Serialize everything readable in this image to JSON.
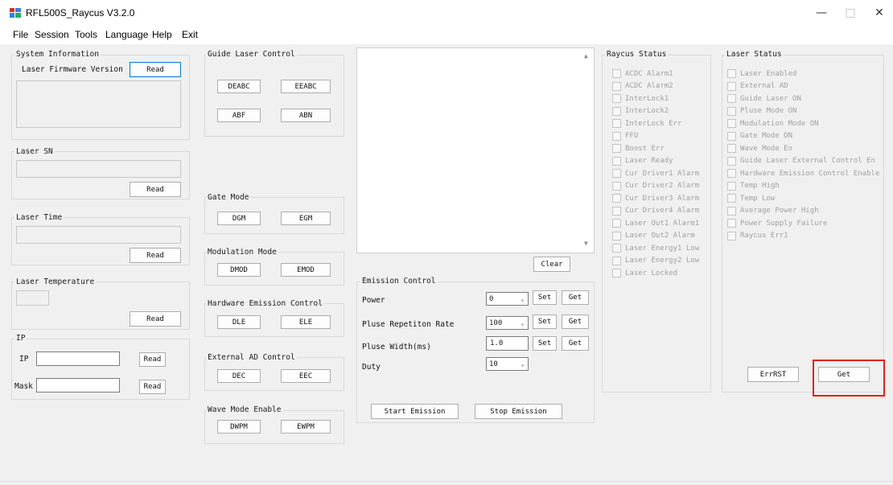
{
  "window": {
    "title": "RFL500S_Raycus V3.2.0"
  },
  "menu": [
    "File",
    "Session",
    "Tools",
    "Language",
    "Help",
    "Exit"
  ],
  "system_info": {
    "title": "System Information",
    "firmware_label": "Laser Firmware Version",
    "read_label": "Read"
  },
  "laser_sn": {
    "title": "Laser SN",
    "read_label": "Read"
  },
  "laser_time": {
    "title": "Laser Time",
    "read_label": "Read"
  },
  "laser_temp": {
    "title": "Laser Temperature",
    "read_label": "Read"
  },
  "ip": {
    "title": "IP",
    "ip_label": "IP",
    "mask_label": "Mask",
    "read_label": "Read"
  },
  "guide_laser": {
    "title": "Guide Laser Control",
    "buttons": [
      "DEABC",
      "EEABC",
      "ABF",
      "ABN"
    ]
  },
  "gate_mode": {
    "title": "Gate Mode",
    "buttons": [
      "DGM",
      "EGM"
    ]
  },
  "modulation_mode": {
    "title": "Modulation Mode",
    "buttons": [
      "DMOD",
      "EMOD"
    ]
  },
  "hardware_emission": {
    "title": "Hardware Emission Control",
    "buttons": [
      "DLE",
      "ELE"
    ]
  },
  "external_ad": {
    "title": "External AD Control",
    "buttons": [
      "DEC",
      "EEC"
    ]
  },
  "wave_mode": {
    "title": "Wave Mode Enable",
    "buttons": [
      "DWPM",
      "EWPM"
    ]
  },
  "log": {
    "clear_label": "Clear"
  },
  "emission": {
    "title": "Emission Control",
    "power_label": "Power",
    "power_value": "0",
    "rate_label": "Pluse Repetiton Rate",
    "rate_value": "100",
    "width_label": "Pluse Width(ms)",
    "width_value": "1.0",
    "duty_label": "Duty",
    "duty_value": "10",
    "set_label": "Set",
    "get_label": "Get",
    "start_label": "Start Emission",
    "stop_label": "Stop Emission"
  },
  "raycus_status": {
    "title": "Raycus Status",
    "items": [
      "ACDC Alarm1",
      "ACDC Alarm2",
      "InterLock1",
      "InterLock2",
      "InterLock Err",
      "FFU",
      "Boost Err",
      "Laser Ready",
      "Cur Driver1 Alarm",
      "Cur Driver2 Alarm",
      "Cur Driver3 Alarm",
      "Cur Driver4 Alarm",
      "Laser Out1 Alarm1",
      "Laser Out2 Alarm",
      "Laser Energy1 Low",
      "Laser Energy2 Low",
      "Laser Locked"
    ]
  },
  "laser_status": {
    "title": "Laser Status",
    "items": [
      "Laser Enabled",
      "External AD",
      "Guide Laser ON",
      "Pluse Mode ON",
      "Modulation Mode ON",
      "Gate Mode ON",
      "Wave Mode En",
      "Guide Laser External Control En",
      "Hardware Emission Control Enable",
      "Temp High",
      "Temp Low",
      "Average Power High",
      "Power Supply Failure",
      "Raycus Err1"
    ],
    "errrst_label": "ErrRST",
    "get_label": "Get"
  },
  "colors": {
    "highlight": "#e0221e",
    "focus": "#0078d7",
    "disabled_text": "#a0a0a0"
  }
}
